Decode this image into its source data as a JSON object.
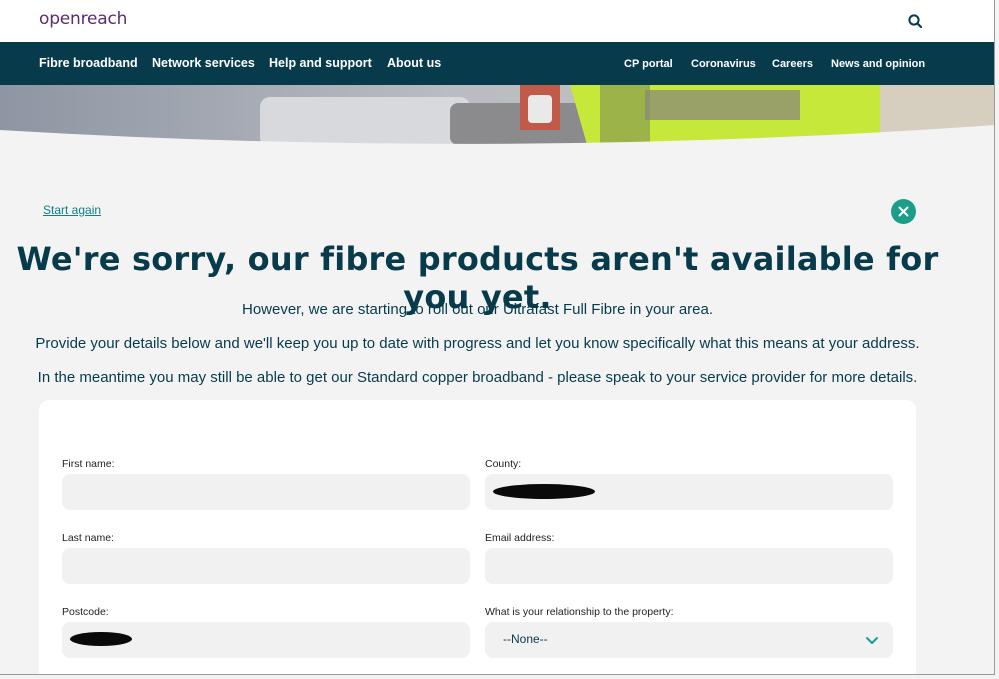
{
  "header": {
    "logo": "openreach",
    "search_icon": "search-icon"
  },
  "nav": {
    "primary": [
      "Fibre broadband",
      "Network services",
      "Help and support",
      "About us"
    ],
    "secondary": [
      "CP portal",
      "Coronavirus",
      "Careers",
      "News and opinion"
    ]
  },
  "page": {
    "start_again": "Start again",
    "close_icon": "close-icon",
    "headline": "We're sorry, our fibre products aren't available for you yet.",
    "para1": "However, we are starting to roll out our Ultrafast Full Fibre in your area.",
    "para2": "Provide your details below and we'll keep you up to date with progress and let you know specifically what this means at your address.",
    "para3": "In the meantime you may still be able to get our Standard copper broadband - please speak to your service provider for more details."
  },
  "form": {
    "first_name_label": "First name:",
    "first_name_value": "",
    "last_name_label": "Last name:",
    "last_name_value": "",
    "postcode_label": "Postcode:",
    "county_label": "County:",
    "email_label": "Email address:",
    "email_value": "",
    "relationship_label": "What is your relationship to the property:",
    "relationship_selected": "--None--"
  },
  "colors": {
    "nav_bg": "#073b4c",
    "accent": "#1a9e8a",
    "logo": "#5b2c6f"
  }
}
